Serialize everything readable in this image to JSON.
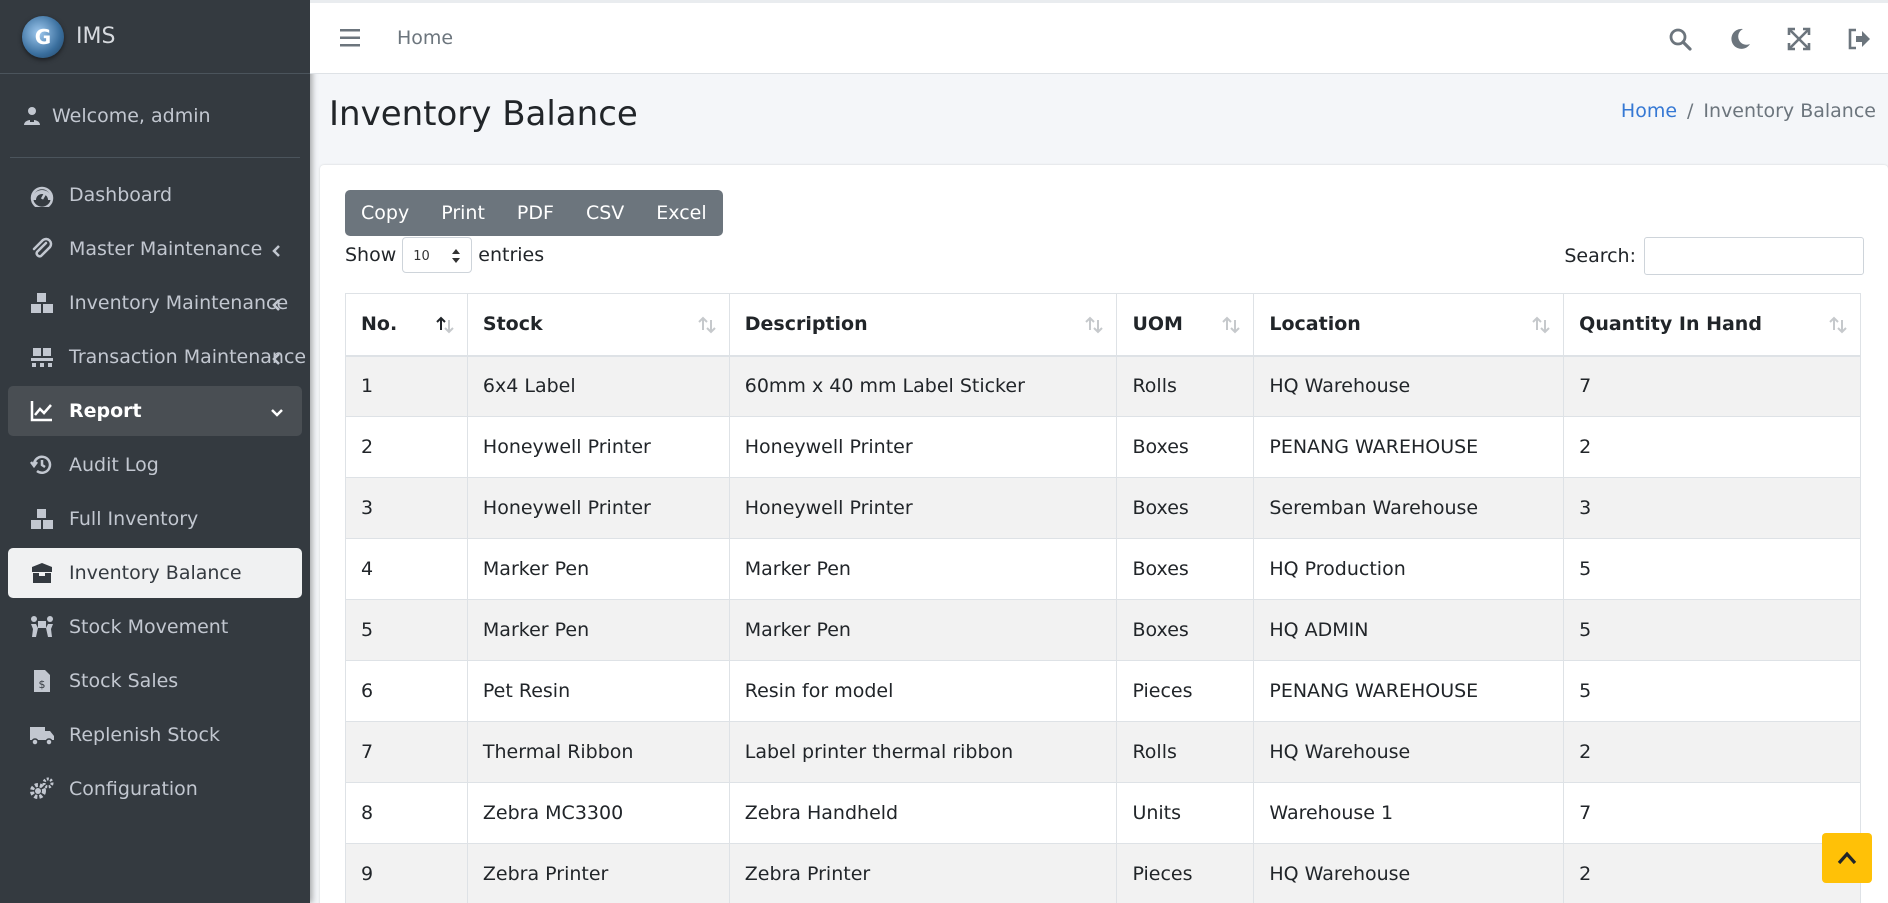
{
  "app": {
    "brand": "IMS",
    "brand_logo_letter": "G"
  },
  "user": {
    "welcome": "Welcome, admin"
  },
  "sidebar": {
    "items": [
      {
        "label": "Dashboard",
        "icon": "tachometer-icon"
      },
      {
        "label": "Master Maintenance",
        "icon": "paperclip-icon",
        "chevron": "left"
      },
      {
        "label": "Inventory Maintenance",
        "icon": "boxes-icon",
        "chevron": "left"
      },
      {
        "label": "Transaction Maintenance",
        "icon": "pallet-icon",
        "chevron": "left"
      },
      {
        "label": "Report",
        "icon": "chart-line-icon",
        "chevron": "down",
        "state": "open"
      },
      {
        "label": "Audit Log",
        "icon": "history-icon"
      },
      {
        "label": "Full Inventory",
        "icon": "boxes-icon"
      },
      {
        "label": "Inventory Balance",
        "icon": "box-open-icon",
        "state": "active"
      },
      {
        "label": "Stock Movement",
        "icon": "people-carry-icon"
      },
      {
        "label": "Stock Sales",
        "icon": "file-invoice-dollar-icon"
      },
      {
        "label": "Replenish Stock",
        "icon": "truck-icon"
      },
      {
        "label": "Configuration",
        "icon": "cogs-icon"
      }
    ]
  },
  "topbar": {
    "home": "Home",
    "tools": [
      "search-icon",
      "moon-icon",
      "expand-icon",
      "sign-out-icon"
    ]
  },
  "page": {
    "title": "Inventory Balance",
    "breadcrumb": {
      "home": "Home",
      "separator": "/",
      "current": "Inventory Balance"
    }
  },
  "toolbar": {
    "buttons": [
      "Copy",
      "Print",
      "PDF",
      "CSV",
      "Excel"
    ]
  },
  "length": {
    "show": "Show",
    "value": "10",
    "entries": "entries"
  },
  "search": {
    "label": "Search:",
    "value": ""
  },
  "table": {
    "columns": [
      "No.",
      "Stock",
      "Description",
      "UOM",
      "Location",
      "Quantity In Hand"
    ],
    "rows": [
      [
        "1",
        "6x4 Label",
        "60mm x 40 mm Label Sticker",
        "Rolls",
        "HQ Warehouse",
        "7"
      ],
      [
        "2",
        "Honeywell Printer",
        "Honeywell Printer",
        "Boxes",
        "PENANG WAREHOUSE",
        "2"
      ],
      [
        "3",
        "Honeywell Printer",
        "Honeywell Printer",
        "Boxes",
        "Seremban Warehouse",
        "3"
      ],
      [
        "4",
        "Marker Pen",
        "Marker Pen",
        "Boxes",
        "HQ Production",
        "5"
      ],
      [
        "5",
        "Marker Pen",
        "Marker Pen",
        "Boxes",
        "HQ ADMIN",
        "5"
      ],
      [
        "6",
        "Pet Resin",
        "Resin for model",
        "Pieces",
        "PENANG WAREHOUSE",
        "5"
      ],
      [
        "7",
        "Thermal Ribbon",
        "Label printer thermal ribbon",
        "Rolls",
        "HQ Warehouse",
        "2"
      ],
      [
        "8",
        "Zebra MC3300",
        "Zebra Handheld",
        "Units",
        "Warehouse 1",
        "7"
      ],
      [
        "9",
        "Zebra Printer",
        "Zebra Printer",
        "Pieces",
        "HQ Warehouse",
        "2"
      ]
    ]
  },
  "colors": {
    "sidebar": "#343a40",
    "accent": "#3578d4",
    "scroll_top": "#ffc107",
    "toolbar": "#6c757d"
  }
}
